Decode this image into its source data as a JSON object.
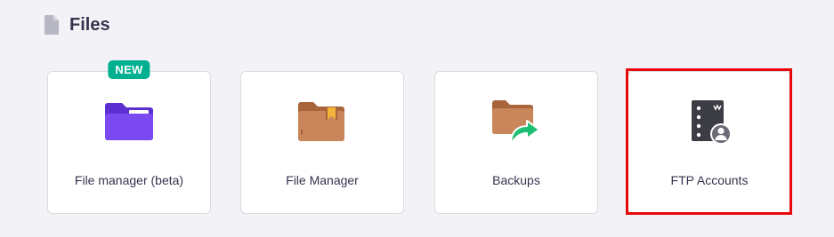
{
  "section": {
    "title": "Files",
    "icon": "file-icon"
  },
  "cards": [
    {
      "label": "File manager (beta)",
      "icon": "purple-folder-icon",
      "badge": "NEW"
    },
    {
      "label": "File Manager",
      "icon": "brown-folder-bookmark-icon"
    },
    {
      "label": "Backups",
      "icon": "folder-restore-arrow-icon"
    },
    {
      "label": "FTP Accounts",
      "icon": "ftp-server-user-icon",
      "highlighted": true
    }
  ],
  "colors": {
    "badge": "#00b090",
    "highlight": "#e8080b",
    "folder_purple": "#6c3ce6",
    "folder_brown": "#c8865a",
    "arrow_green": "#1fbf73"
  }
}
